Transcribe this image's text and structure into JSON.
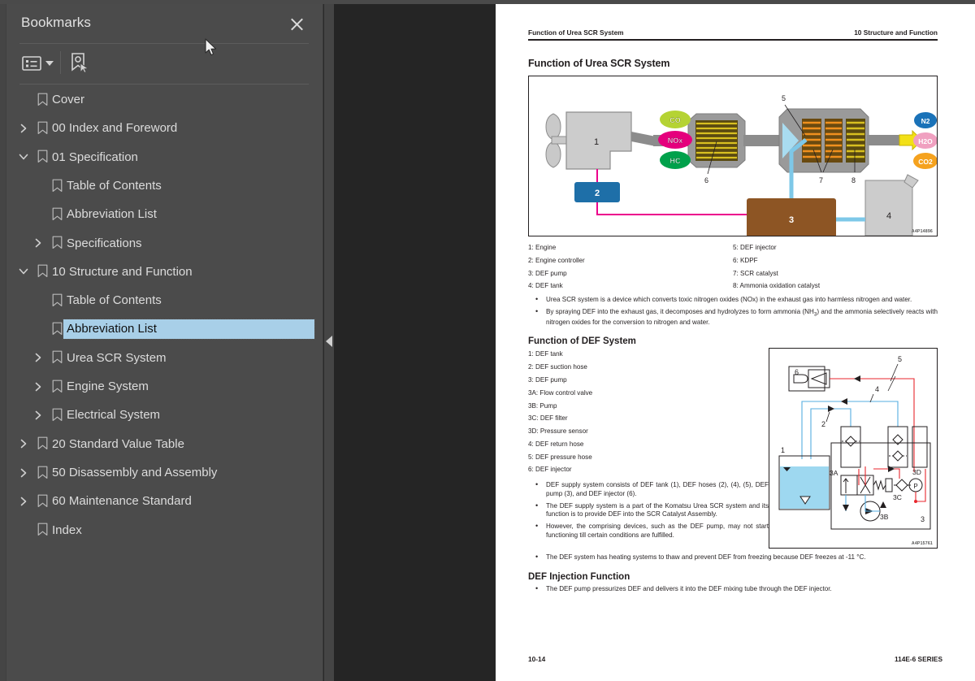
{
  "panel": {
    "title": "Bookmarks",
    "close_icon": "close-icon",
    "toolbar": {
      "list_options_icon": "list-options-icon",
      "caret_icon": "chevron-down-icon",
      "add_bookmark_icon": "add-bookmark-icon"
    },
    "items": [
      {
        "label": "Cover",
        "depth": 1,
        "twisty": "none",
        "icon": "bookmark-icon",
        "selected": false
      },
      {
        "label": "00 Index and Foreword",
        "depth": 1,
        "twisty": "collapsed",
        "icon": "bookmark-icon",
        "selected": false
      },
      {
        "label": "01 Specification",
        "depth": 1,
        "twisty": "expanded",
        "icon": "bookmark-icon",
        "selected": false
      },
      {
        "label": "Table of Contents",
        "depth": 2,
        "twisty": "none",
        "icon": "bookmark-icon",
        "selected": false
      },
      {
        "label": "Abbreviation List",
        "depth": 2,
        "twisty": "none",
        "icon": "bookmark-icon",
        "selected": false
      },
      {
        "label": "Specifications",
        "depth": 2,
        "twisty": "collapsed",
        "icon": "bookmark-icon",
        "selected": false
      },
      {
        "label": "10 Structure and Function",
        "depth": 1,
        "twisty": "expanded",
        "icon": "bookmark-icon",
        "selected": false
      },
      {
        "label": "Table of Contents",
        "depth": 2,
        "twisty": "none",
        "icon": "bookmark-icon",
        "selected": false
      },
      {
        "label": "Abbreviation List",
        "depth": 2,
        "twisty": "none",
        "icon": "bookmark-icon",
        "selected": true
      },
      {
        "label": "Urea SCR System",
        "depth": 2,
        "twisty": "collapsed",
        "icon": "bookmark-icon",
        "selected": false
      },
      {
        "label": "Engine System",
        "depth": 2,
        "twisty": "collapsed",
        "icon": "bookmark-icon",
        "selected": false
      },
      {
        "label": "Electrical System",
        "depth": 2,
        "twisty": "collapsed",
        "icon": "bookmark-icon",
        "selected": false
      },
      {
        "label": "20 Standard Value Table",
        "depth": 1,
        "twisty": "collapsed",
        "icon": "bookmark-icon",
        "selected": false
      },
      {
        "label": "50 Disassembly and Assembly",
        "depth": 1,
        "twisty": "collapsed",
        "icon": "bookmark-icon",
        "selected": false
      },
      {
        "label": "60 Maintenance Standard",
        "depth": 1,
        "twisty": "collapsed",
        "icon": "bookmark-icon",
        "selected": false
      },
      {
        "label": "Index",
        "depth": 1,
        "twisty": "none",
        "icon": "bookmark-icon",
        "selected": false
      }
    ]
  },
  "viewer": {
    "collapse_icon": "collapse-panel-arrow-icon"
  },
  "document": {
    "header_left": "Function of Urea SCR System",
    "header_right": "10 Structure and Function",
    "section1_title": "Function of Urea SCR System",
    "figure1": {
      "code": "A4P14896",
      "node_labels": [
        "1",
        "2",
        "3",
        "4",
        "5",
        "6",
        "7",
        "8"
      ],
      "gas_in": [
        {
          "text": "CO",
          "color": "#b5d334"
        },
        {
          "text": "NOx",
          "color": "#e5007d"
        },
        {
          "text": "HC",
          "color": "#00a14b"
        }
      ],
      "gas_out": [
        {
          "text": "N2",
          "color": "#1a72b8"
        },
        {
          "text": "H2O",
          "color": "#f0a0c0"
        },
        {
          "text": "CO2",
          "color": "#f5a21e"
        }
      ]
    },
    "legend1_left": [
      "1: Engine",
      "2: Engine controller",
      "3: DEF pump",
      "4: DEF tank"
    ],
    "legend1_right": [
      "5: DEF injector",
      "6: KDPF",
      "7: SCR catalyst",
      "8: Ammonia oxidation catalyst"
    ],
    "bullets1": [
      "Urea SCR system is a device which converts toxic nitrogen oxides (NOx) in the exhaust gas into harmless nitrogen and water.",
      "By spraying DEF into the exhaust gas, it decomposes and hydrolyzes to form ammonia (NH3) and the ammonia selectively reacts with nitrogen oxides for the conversion to nitrogen and water."
    ],
    "section2_title": "Function of DEF System",
    "legend2": [
      "1: DEF tank",
      "2: DEF suction hose",
      "3: DEF pump",
      "3A: Flow control valve",
      "3B: Pump",
      "3C: DEF filter",
      "3D: Pressure sensor",
      "4: DEF return hose",
      "5: DEF pressure hose",
      "6: DEF injector"
    ],
    "figure2": {
      "code": "A4P15761",
      "node_labels": [
        "1",
        "2",
        "3",
        "3A",
        "3B",
        "3C",
        "3D",
        "4",
        "5",
        "6",
        "P"
      ]
    },
    "bullets2": [
      "DEF supply system consists of DEF tank (1), DEF hoses (2), (4), (5), DEF pump (3), and DEF injector (6).",
      "The DEF supply system is a part of the Komatsu Urea SCR system and its function is to provide DEF into the SCR Catalyst Assembly.",
      "However, the comprising devices, such as the DEF pump, may not start functioning till certain conditions are fulfilled."
    ],
    "bullets3": [
      "The DEF system has heating systems to thaw and prevent DEF from freezing because DEF freezes at -11 °C."
    ],
    "section3_title": "DEF Injection Function",
    "bullets4": [
      "The DEF pump pressurizes DEF and delivers it into the DEF mixing tube through the DEF injector."
    ],
    "footer_left": "10-14",
    "footer_right": "114E-6 SERIES"
  }
}
